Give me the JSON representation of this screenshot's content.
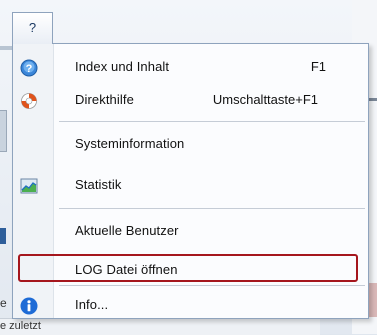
{
  "menubar": {
    "help_tab_label": "?"
  },
  "menu": {
    "items": [
      {
        "label": "Index und Inhalt",
        "shortcut": "F1",
        "icon": "help-icon"
      },
      {
        "label": "Direkthilfe",
        "shortcut": "Umschalttaste+F1",
        "icon": "lifebuoy-icon"
      },
      {
        "label": "Systeminformation",
        "shortcut": "",
        "icon": ""
      },
      {
        "label": "Statistik",
        "shortcut": "",
        "icon": "chart-icon"
      },
      {
        "label": "Aktuelle Benutzer",
        "shortcut": "",
        "icon": ""
      },
      {
        "label": "LOG Datei öffnen",
        "shortcut": "",
        "icon": ""
      },
      {
        "label": "Info...",
        "shortcut": "",
        "icon": "info-icon"
      }
    ]
  },
  "background": {
    "bottom_text": "e zuletzt",
    "side_letter": "e"
  },
  "colors": {
    "highlight_border": "#a5161d",
    "menu_border": "#8ea3bd",
    "info_blue": "#1e6bd6"
  }
}
